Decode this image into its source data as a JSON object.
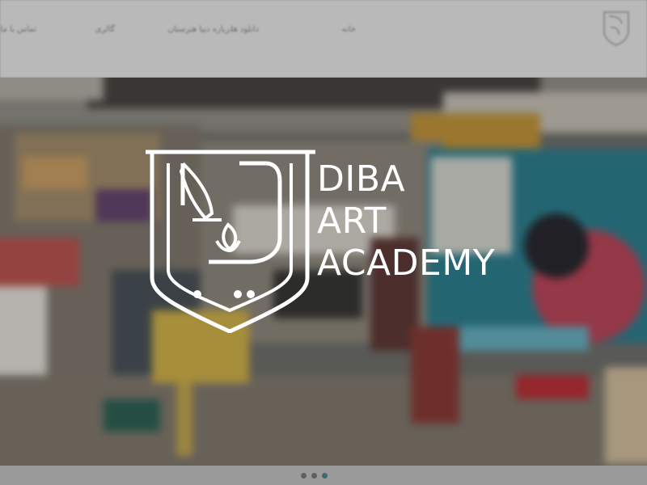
{
  "header": {
    "nav": [
      {
        "label": "خانه"
      },
      {
        "label": "دانلود ها"
      },
      {
        "label": "درباره دیبا هنرستان"
      },
      {
        "label": "گالری"
      },
      {
        "label": "تماس با ما"
      }
    ]
  },
  "hero": {
    "brand_lines": [
      "DIBA",
      "ART",
      "ACADEMY"
    ],
    "slides_count": 3,
    "active_slide": 3
  },
  "colors": {
    "header_bg": "#b9b9b9",
    "brand_white": "#ffffff",
    "dot_active": "#3e6b6b",
    "dot_inactive": "#5f5f5f"
  },
  "icons": {
    "logo": "diba-crest-logo",
    "small_logo": "diba-crest-small-logo"
  }
}
